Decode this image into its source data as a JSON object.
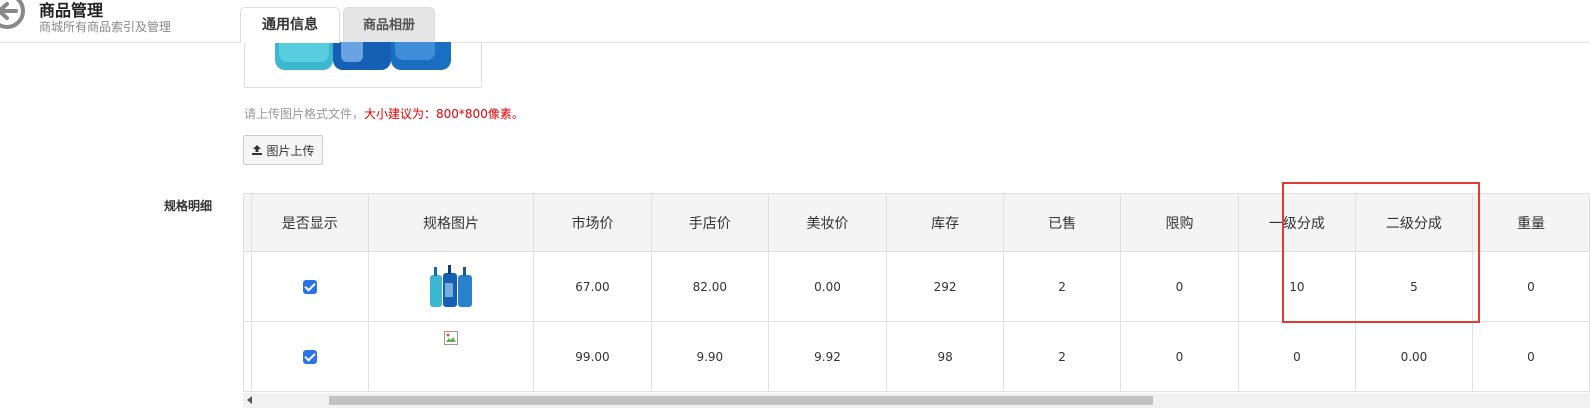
{
  "header": {
    "title": "商品管理",
    "subtitle": "商城所有商品索引及管理",
    "tabs": [
      {
        "label": "通用信息",
        "active": true
      },
      {
        "label": "商品相册",
        "active": false
      }
    ]
  },
  "upload": {
    "hint_gray": "请上传图片格式文件，",
    "hint_red": "大小建议为：800*800像素。",
    "button_label": "图片上传",
    "button_icon": "upload-icon"
  },
  "spec": {
    "label": "规格明细",
    "columns": [
      "是否显示",
      "规格图片",
      "市场价",
      "手店价",
      "美妆价",
      "库存",
      "已售",
      "限购",
      "一级分成",
      "二级分成",
      "重量"
    ],
    "rows": [
      {
        "show": true,
        "image": "product-bottles",
        "market_price": "67.00",
        "shop_price": "82.00",
        "beauty_price": "0.00",
        "stock": "292",
        "sold": "2",
        "limit": "0",
        "level1": "10",
        "level2": "5",
        "weight": "0"
      },
      {
        "show": true,
        "image": "broken-image",
        "market_price": "99.00",
        "shop_price": "9.90",
        "beauty_price": "9.92",
        "stock": "98",
        "sold": "2",
        "limit": "0",
        "level1": "0",
        "level2": "0.00",
        "weight": "0"
      }
    ]
  },
  "colors": {
    "accent_red": "#e53935",
    "hint_red": "#e00000",
    "checkbox_blue": "#2b73e9"
  }
}
